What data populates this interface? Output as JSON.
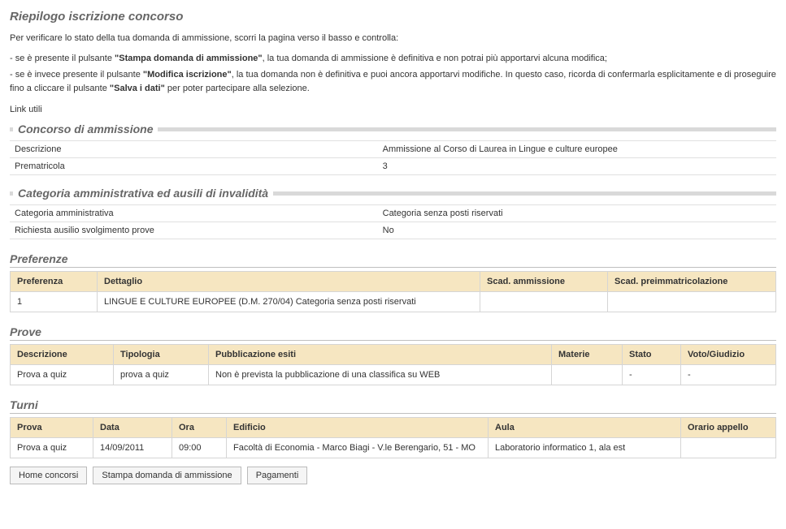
{
  "page_title": "Riepilogo iscrizione concorso",
  "intro": "Per verificare lo stato della tua domanda di ammissione, scorri la pagina verso il basso e controlla:",
  "bullets": {
    "b1_prefix": "- se è presente il pulsante ",
    "b1_strong": "\"Stampa domanda di ammissione\"",
    "b1_suffix": ", la tua domanda di ammissione è definitiva e non potrai più apportarvi alcuna modifica;",
    "b2_prefix": "- se è invece presente il pulsante ",
    "b2_strong1": "\"Modifica iscrizione\"",
    "b2_mid": ", la tua domanda non è definitiva e puoi ancora apportarvi modifiche. In questo caso, ricorda di confermarla esplicitamente e di proseguire fino a cliccare il pulsante ",
    "b2_strong2": "\"Salva i dati\"",
    "b2_suffix": " per poter partecipare alla selezione."
  },
  "link_utili_label": "Link utili",
  "fieldsets": {
    "concorso": {
      "legend": "Concorso di ammissione",
      "rows": [
        {
          "key": "Descrizione",
          "value": "Ammissione al Corso di Laurea in Lingue e culture europee"
        },
        {
          "key": "Prematricola",
          "value": "3"
        }
      ]
    },
    "categoria": {
      "legend": "Categoria amministrativa ed ausili di invalidità",
      "rows": [
        {
          "key": "Categoria amministrativa",
          "value": "Categoria senza posti riservati"
        },
        {
          "key": "Richiesta ausilio svolgimento prove",
          "value": "No"
        }
      ]
    }
  },
  "sections": {
    "preferenze": {
      "title": "Preferenze",
      "headers": [
        "Preferenza",
        "Dettaglio",
        "Scad. ammissione",
        "Scad. preimmatricolazione"
      ],
      "rows": [
        {
          "c0": "1",
          "c1": "LINGUE E CULTURE EUROPEE (D.M. 270/04) Categoria senza posti riservati",
          "c2": "",
          "c3": ""
        }
      ]
    },
    "prove": {
      "title": "Prove",
      "headers": [
        "Descrizione",
        "Tipologia",
        "Pubblicazione esiti",
        "Materie",
        "Stato",
        "Voto/Giudizio"
      ],
      "rows": [
        {
          "c0": "Prova a quiz",
          "c1": "prova a quiz",
          "c2": "Non è prevista la pubblicazione di una classifica su WEB",
          "c3": "",
          "c4": "-",
          "c5": "-"
        }
      ]
    },
    "turni": {
      "title": "Turni",
      "headers": [
        "Prova",
        "Data",
        "Ora",
        "Edificio",
        "Aula",
        "Orario appello"
      ],
      "rows": [
        {
          "c0": "Prova a quiz",
          "c1": "14/09/2011",
          "c2": "09:00",
          "c3": "Facoltà di Economia - Marco Biagi - V.le Berengario, 51 - MO",
          "c4": "Laboratorio informatico 1, ala est",
          "c5": ""
        }
      ]
    }
  },
  "buttons": {
    "home": "Home concorsi",
    "stampa": "Stampa domanda di ammissione",
    "pagamenti": "Pagamenti"
  }
}
